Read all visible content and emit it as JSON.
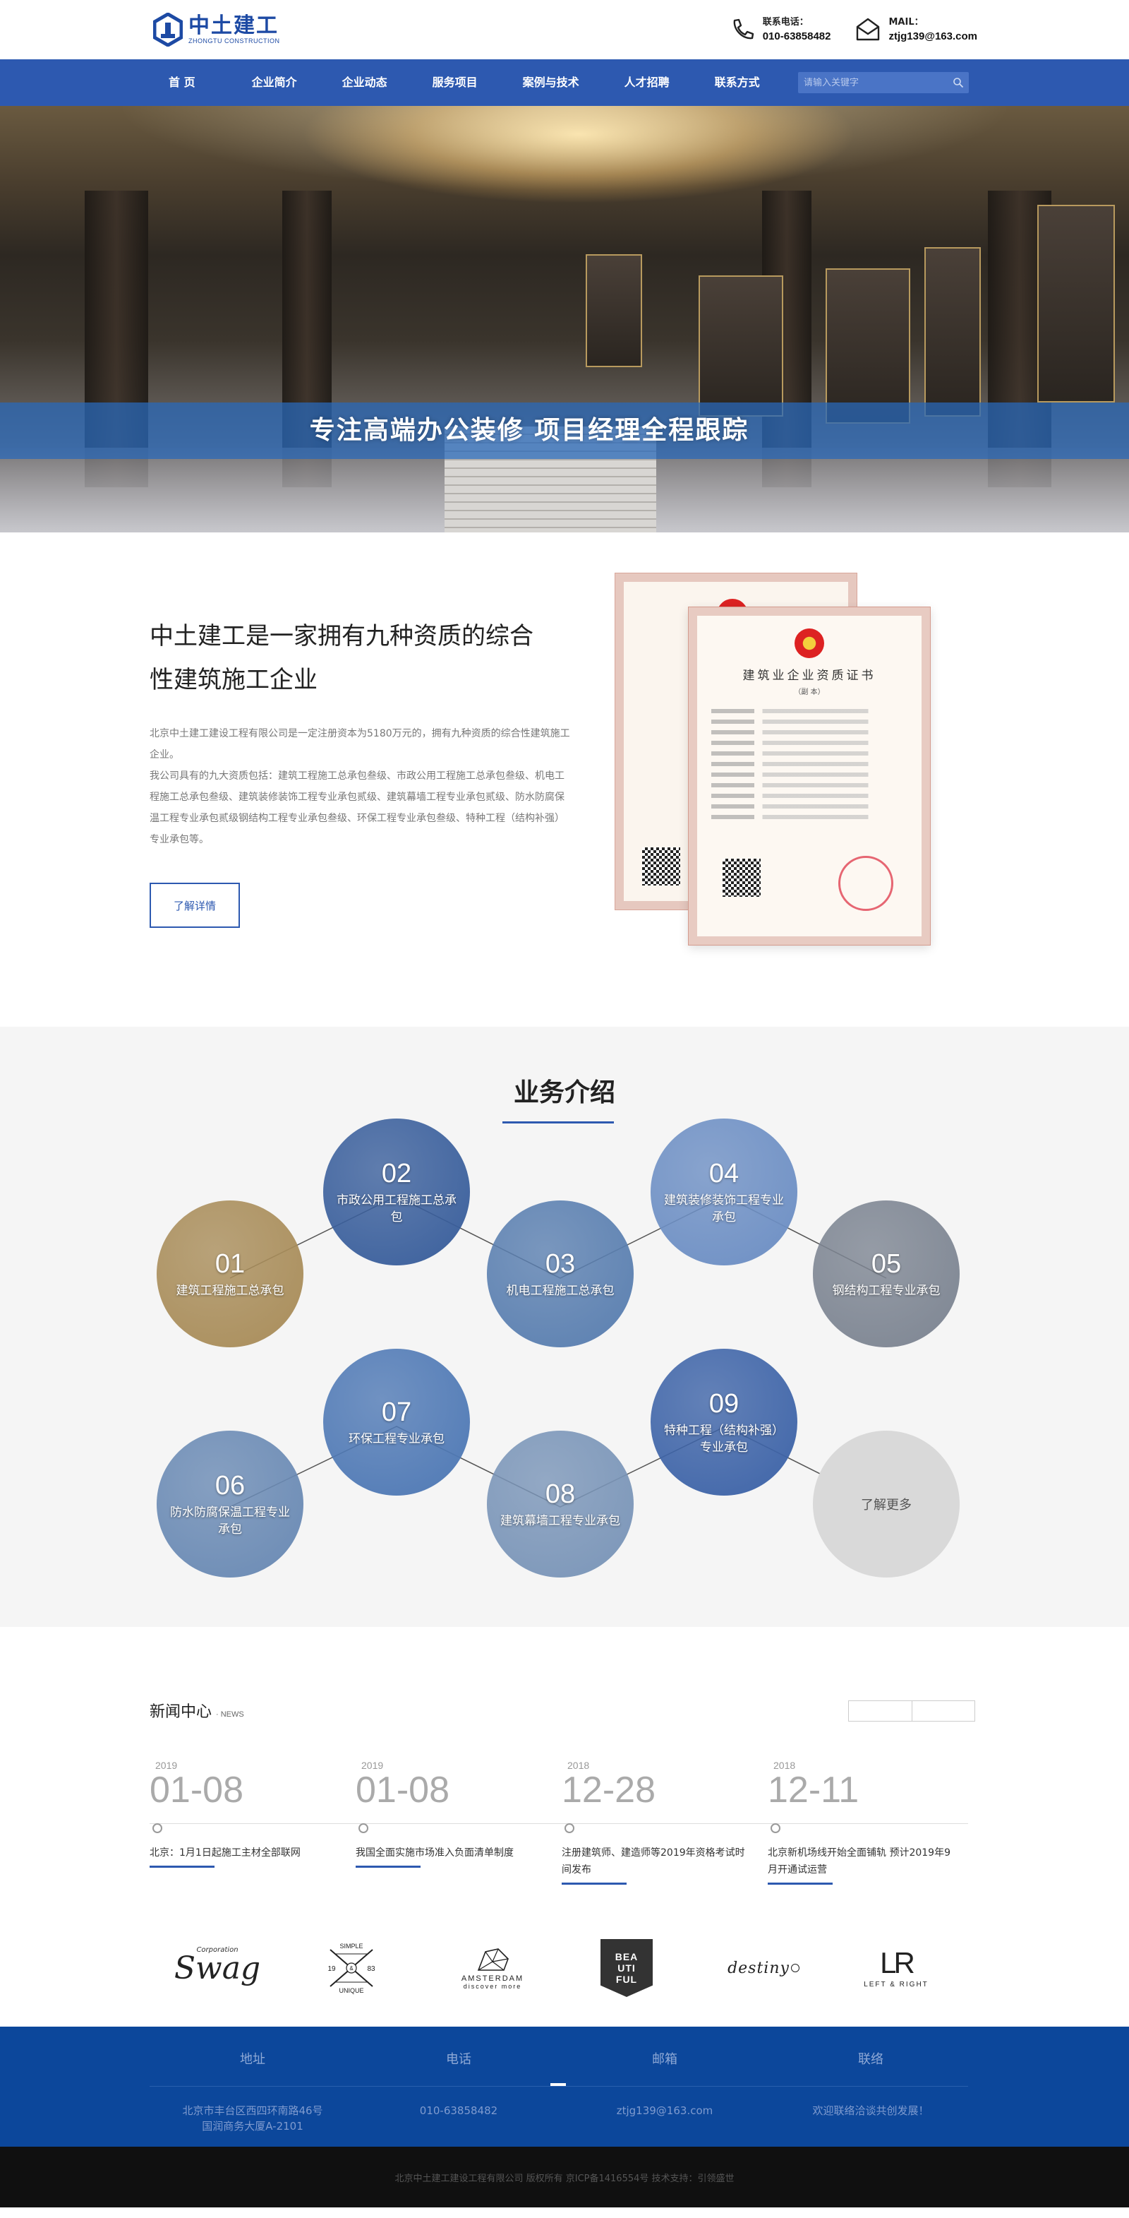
{
  "header": {
    "logo_cn": "中土建工",
    "logo_en": "ZHONGTU CONSTRUCTION",
    "phone_label": "联系电话：",
    "phone": "010-63858482",
    "mail_label": "MAIL：",
    "mail": "ztjg139@163.com"
  },
  "nav": {
    "items": [
      "首 页",
      "企业简介",
      "企业动态",
      "服务项目",
      "案例与技术",
      "人才招聘",
      "联系方式"
    ],
    "search_placeholder": "请输入关键字"
  },
  "banner": {
    "slogan": "专注高端办公装修    项目经理全程跟踪"
  },
  "about": {
    "title_line1": "中土建工是一家拥有九种资质的综合",
    "title_line2": "性建筑施工企业",
    "desc1": "北京中土建工建设工程有限公司是一定注册资本为5180万元的，拥有九种资质的综合性建筑施工企业。",
    "desc2": "我公司具有的九大资质包括：建筑工程施工总承包叁级、市政公用工程施工总承包叁级、机电工程施工总承包叁级、建筑装修装饰工程专业承包贰级、建筑幕墙工程专业承包贰级、防水防腐保温工程专业承包贰级钢结构工程专业承包叁级、环保工程专业承包叁级、特种工程（结构补强）专业承包等。",
    "button": "了解详情",
    "cert_title": "建筑业企业资质证书",
    "cert_sub": "（副 本）"
  },
  "business": {
    "title": "业务介绍",
    "items": [
      {
        "num": "01",
        "label": "建筑工程施工总承包",
        "color": "#a98d5a"
      },
      {
        "num": "02",
        "label": "市政公用工程施工总承包",
        "color": "#3a5f9c"
      },
      {
        "num": "03",
        "label": "机电工程施工总承包",
        "color": "#5a7fb0"
      },
      {
        "num": "04",
        "label": "建筑装修装饰工程专业承包",
        "color": "#6d8fc4"
      },
      {
        "num": "05",
        "label": "钢结构工程专业承包",
        "color": "#7d8592"
      },
      {
        "num": "06",
        "label": "防水防腐保温工程专业承包",
        "color": "#6a8ab4"
      },
      {
        "num": "07",
        "label": "环保工程专业承包",
        "color": "#4f79b5"
      },
      {
        "num": "08",
        "label": "建筑幕墙工程专业承包",
        "color": "#7a95b8"
      },
      {
        "num": "09",
        "label": "特种工程（结构补强）专业承包",
        "color": "#3e64a8"
      }
    ],
    "more": "了解更多"
  },
  "news": {
    "title": "新闻中心",
    "title_en": "· NEWS",
    "items": [
      {
        "year": "2019",
        "date": "01-08",
        "text": "北京：1月1日起施工主材全部联网"
      },
      {
        "year": "2019",
        "date": "01-08",
        "text": "我国全面实施市场准入负面清单制度"
      },
      {
        "year": "2018",
        "date": "12-28",
        "text": "注册建筑师、建造师等2019年资格考试时间发布"
      },
      {
        "year": "2018",
        "date": "12-11",
        "text": "北京新机场线开始全面铺轨 预计2019年9月开通试运营"
      }
    ]
  },
  "partners": {
    "swag": "Swag",
    "swag_sub": "Corporation",
    "simple_top": "SIMPLE",
    "simple_bottom": "UNIQUE",
    "simple_l": "19",
    "simple_r": "83",
    "simple_c": "&",
    "amsterdam": "AMSTERDAM",
    "amsterdam_sub": "discover more",
    "beautiful": [
      "BEA",
      "UTI",
      "FUL"
    ],
    "destiny": "destiny",
    "lr": "LR",
    "lr_sub": "LEFT & RIGHT"
  },
  "footer": {
    "cols": [
      {
        "h": "地址",
        "v1": "北京市丰台区西四环南路46号",
        "v2": "国润商务大厦A-2101"
      },
      {
        "h": "电话",
        "v1": "010-63858482",
        "v2": ""
      },
      {
        "h": "邮箱",
        "v1": "ztjg139@163.com",
        "v2": ""
      },
      {
        "h": "联络",
        "v1": "欢迎联络洽谈共创发展！",
        "v2": ""
      }
    ],
    "copyright": "北京中土建工建设工程有限公司 版权所有 京ICP备1416554号 技术支持：引领盛世"
  },
  "colors": {
    "brand": "#2d59b0",
    "footer": "#0c479b"
  }
}
